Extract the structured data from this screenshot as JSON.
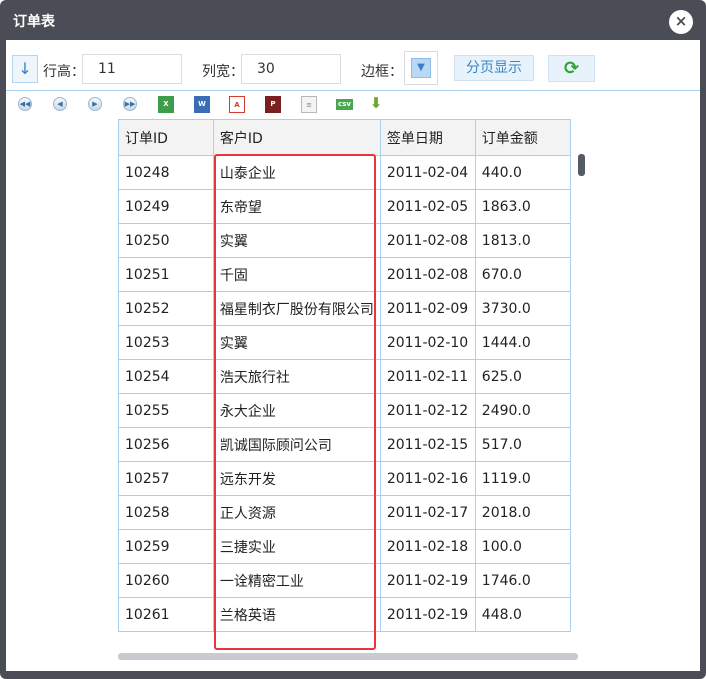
{
  "window": {
    "title": "订单表",
    "close_label": "×"
  },
  "toolbar": {
    "sort_icon": "↓",
    "row_height_label": "行高：",
    "row_height_value": "11",
    "col_width_label": "列宽：",
    "col_width_value": "30",
    "border_label": "边框：",
    "border_icon": "chevron-down-icon",
    "paging_label": "分页显示",
    "refresh_icon": "refresh-icon"
  },
  "export_toolbar": {
    "icons": [
      "first-page-icon",
      "prev-page-icon",
      "next-page-icon",
      "last-page-icon",
      "excel-icon",
      "word-icon",
      "pdf-icon",
      "print-icon",
      "text-file-icon",
      "csv-icon",
      "download-icon"
    ]
  },
  "grid": {
    "columns": [
      "订单ID",
      "客户ID",
      "签单日期",
      "订单金额"
    ],
    "rows": [
      [
        "10248",
        "山泰企业",
        "2011-02-04",
        "440.0"
      ],
      [
        "10249",
        "东帝望",
        "2011-02-05",
        "1863.0"
      ],
      [
        "10250",
        "实翼",
        "2011-02-08",
        "1813.0"
      ],
      [
        "10251",
        "千固",
        "2011-02-08",
        "670.0"
      ],
      [
        "10252",
        "福星制衣厂股份有限公司",
        "2011-02-09",
        "3730.0"
      ],
      [
        "10253",
        "实翼",
        "2011-02-10",
        "1444.0"
      ],
      [
        "10254",
        "浩天旅行社",
        "2011-02-11",
        "625.0"
      ],
      [
        "10255",
        "永大企业",
        "2011-02-12",
        "2490.0"
      ],
      [
        "10256",
        "凯诚国际顾问公司",
        "2011-02-15",
        "517.0"
      ],
      [
        "10257",
        "远东开发",
        "2011-02-16",
        "1119.0"
      ],
      [
        "10258",
        "正人资源",
        "2011-02-17",
        "2018.0"
      ],
      [
        "10259",
        "三捷实业",
        "2011-02-18",
        "100.0"
      ],
      [
        "10260",
        "一诠精密工业",
        "2011-02-19",
        "1746.0"
      ],
      [
        "10261",
        "兰格英语",
        "2011-02-19",
        "448.0"
      ]
    ]
  },
  "colors": {
    "titlebar": "#4a4d56",
    "grid_border": "#a9d0ee",
    "highlight": "#e8343b",
    "accent": "#3a86c8"
  }
}
